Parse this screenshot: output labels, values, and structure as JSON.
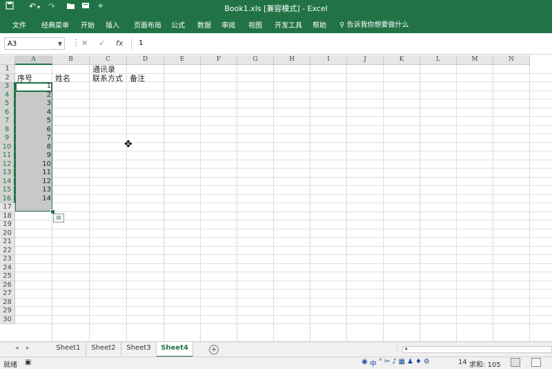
{
  "window": {
    "title": "Book1.xls [兼容模式] - Excel",
    "quick_access": [
      "save-icon",
      "undo-icon",
      "redo-icon",
      "open-folder-icon",
      "print-preview-icon",
      "customize-icon"
    ]
  },
  "ribbon": {
    "tabs": [
      "文件",
      "经典菜单",
      "开始",
      "插入",
      "页面布局",
      "公式",
      "数据",
      "审阅",
      "视图",
      "开发工具",
      "帮助"
    ],
    "tell_me": "告诉我你想要做什么"
  },
  "formula_bar": {
    "name_box": "A3",
    "value": "1",
    "cancel_glyph": "✕",
    "enter_glyph": "✓",
    "fx_glyph": "fx"
  },
  "sheet": {
    "columns": [
      "A",
      "B",
      "C",
      "D",
      "E",
      "F",
      "G",
      "H",
      "I",
      "J",
      "K",
      "L",
      "M",
      "N"
    ],
    "rows": [
      "1",
      "2",
      "3",
      "4",
      "5",
      "6",
      "7",
      "8",
      "9",
      "10",
      "11",
      "12",
      "13",
      "14",
      "15",
      "16",
      "17",
      "18",
      "19",
      "20",
      "21",
      "22",
      "23",
      "24",
      "25",
      "26",
      "27",
      "28",
      "29",
      "30"
    ],
    "cells": {
      "C1": "通讯录",
      "A2": "序号",
      "B2": "姓名",
      "C2": "联系方式",
      "D2": "备注"
    },
    "serials": [
      "1",
      "2",
      "3",
      "4",
      "5",
      "6",
      "7",
      "8",
      "9",
      "10",
      "11",
      "12",
      "13",
      "14"
    ],
    "selection": "A3:A16",
    "accent_color": "#217346"
  },
  "sheet_tabs": {
    "tabs": [
      "Sheet1",
      "Sheet2",
      "Sheet3",
      "Sheet4"
    ],
    "active": "Sheet4"
  },
  "status": {
    "ready": "就绪",
    "count_fragment": "14",
    "sum": "求和: 105"
  }
}
